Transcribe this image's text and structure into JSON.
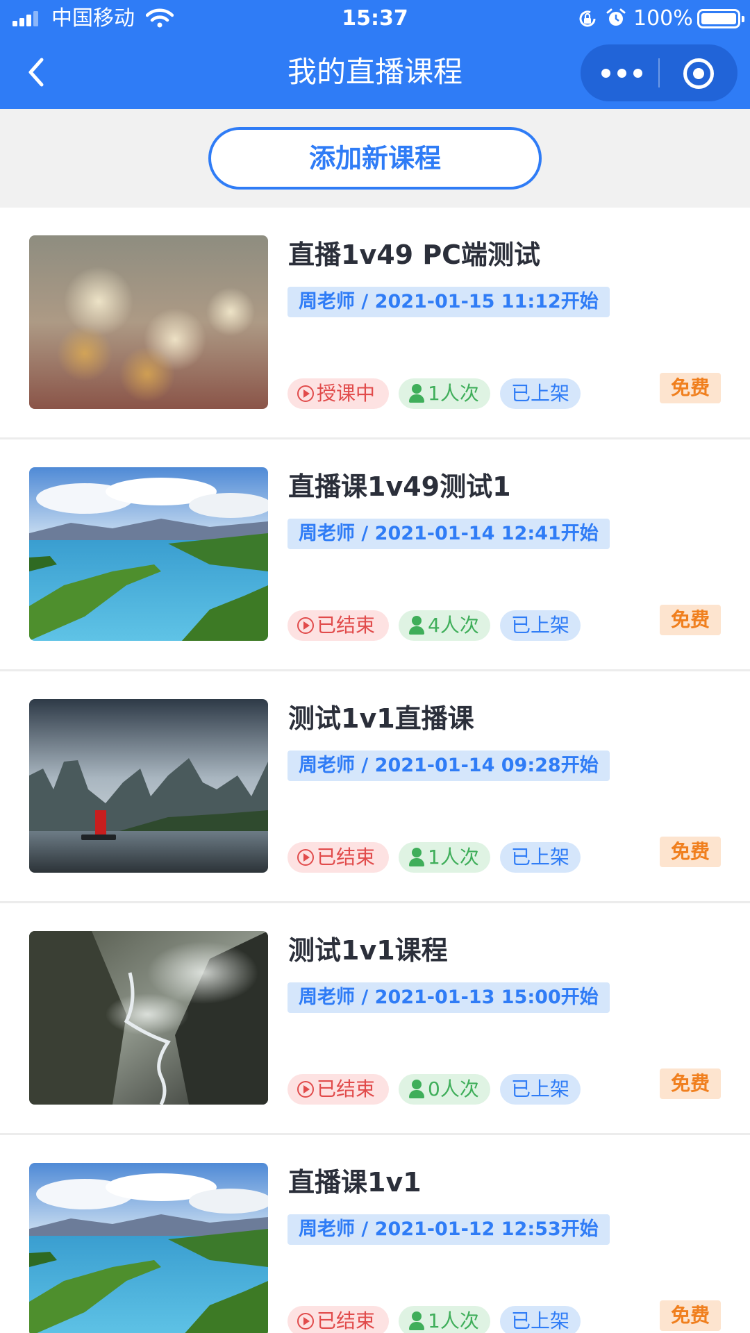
{
  "status_bar": {
    "carrier": "中国移动",
    "time": "15:37",
    "battery": "100%"
  },
  "nav": {
    "title": "我的直播课程"
  },
  "actions": {
    "add_label": "添加新课程"
  },
  "courses": [
    {
      "title": "直播1v49 PC端测试",
      "meta": "周老师 / 2021-01-15 11:12开始",
      "status": "授课中",
      "count": "1人次",
      "shelf": "已上架",
      "price": "免费"
    },
    {
      "title": "直播课1v49测试1",
      "meta": "周老师 / 2021-01-14 12:41开始",
      "status": "已结束",
      "count": "4人次",
      "shelf": "已上架",
      "price": "免费"
    },
    {
      "title": "测试1v1直播课",
      "meta": "周老师 / 2021-01-14 09:28开始",
      "status": "已结束",
      "count": "1人次",
      "shelf": "已上架",
      "price": "免费"
    },
    {
      "title": "测试1v1课程",
      "meta": "周老师 / 2021-01-13 15:00开始",
      "status": "已结束",
      "count": "0人次",
      "shelf": "已上架",
      "price": "免费"
    },
    {
      "title": "直播课1v1",
      "meta": "周老师 / 2021-01-12 12:53开始",
      "status": "已结束",
      "count": "1人次",
      "shelf": "已上架",
      "price": "免费"
    }
  ],
  "colors": {
    "primary": "#2f7cf6",
    "status_red": "#e14b4b",
    "count_green": "#3fae5a",
    "price_orange": "#f07f1e"
  },
  "icons": [
    "signal-icon",
    "wifi-icon",
    "rotation-lock-icon",
    "alarm-icon",
    "battery-icon",
    "back-icon",
    "more-icon",
    "target-icon",
    "play-circle-icon",
    "person-icon"
  ]
}
